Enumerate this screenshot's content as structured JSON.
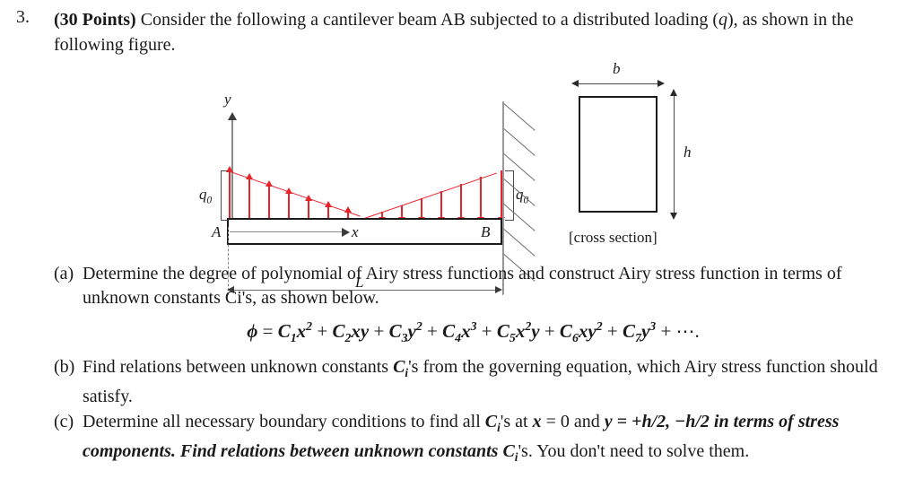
{
  "problem": {
    "number": "3.",
    "points_label": "(30 Points)",
    "points_bold": "30 Points",
    "statement_before": "Consider the following a cantilever beam AB subjected to a distributed loading (",
    "statement_q": "q",
    "statement_after": "), as shown in the following figure."
  },
  "figure": {
    "y_axis_label": "y",
    "x_axis_label": "x",
    "point_a_label": "A",
    "point_b_label": "B",
    "load_label_left": "q",
    "load_label_left_sub": "0",
    "load_label_right": "q",
    "load_label_right_sub": "0",
    "span_label": "L",
    "load_color": "#e8232a",
    "beam_color": "#1b1b1b",
    "wall_color": "#9a9a9a",
    "dimension_color": "#6d6d6d",
    "left_arrows_up": 7,
    "right_arrows_down": 7
  },
  "cross_section": {
    "width_label": "b",
    "height_label": "h",
    "caption": "[cross section]"
  },
  "parts": [
    {
      "tag": "(a)",
      "text": "Determine the degree of polynomial of Airy stress functions and construct Airy stress function in terms of unknown constants Ci's, as shown below."
    },
    {
      "tag": "(b)",
      "text_1": "Find relations between unknown constants ",
      "text_c": "C",
      "text_c_sub": "i",
      "text_2": "'s from the governing equation, which Airy stress function should satisfy."
    },
    {
      "tag": "(c)",
      "text_1": "Determine all necessary boundary conditions to find all ",
      "text_c": "C",
      "text_c_sub": "i",
      "text_2": "'s at ",
      "text_x": "x",
      "text_3": " = 0 and ",
      "text_y": "y",
      "text_4": " = +h/2, −h/2 in terms of stress components. Find relations between unknown constants ",
      "text_c2": "C",
      "text_c2_sub": "i",
      "text_5": "'s. You don't need to solve them."
    }
  ],
  "equation": {
    "lhs": "ϕ",
    "eq": "=",
    "terms": [
      {
        "coef": "C",
        "sub": "1",
        "vars": "x",
        "pow": "2"
      },
      {
        "coef": "C",
        "sub": "2",
        "vars": "xy",
        "pow": ""
      },
      {
        "coef": "C",
        "sub": "3",
        "vars": "y",
        "pow": "2"
      },
      {
        "coef": "C",
        "sub": "4",
        "vars": "x",
        "pow": "3"
      },
      {
        "coef": "C",
        "sub": "5",
        "vars": "x",
        "pow": "2",
        "tail": "y"
      },
      {
        "coef": "C",
        "sub": "6",
        "vars": "xy",
        "pow": "2"
      },
      {
        "coef": "C",
        "sub": "7",
        "vars": "y",
        "pow": "3"
      }
    ],
    "ellipsis": "+ ⋯."
  }
}
